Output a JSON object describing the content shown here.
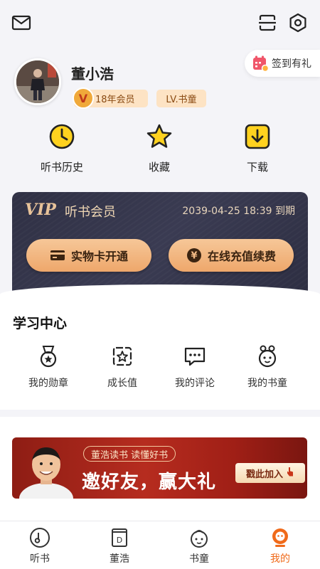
{
  "header": {
    "mail_icon": "mail-icon",
    "scan_icon": "scan-icon",
    "settings_icon": "settings-icon",
    "signin_label": "签到有礼"
  },
  "profile": {
    "name": "董小浩",
    "vip_badge": "18年会员",
    "vip_badge_mark": "V",
    "level_badge": "LV.书童"
  },
  "quick_actions": [
    {
      "label": "听书历史",
      "icon": "clock-icon"
    },
    {
      "label": "收藏",
      "icon": "star-icon"
    },
    {
      "label": "下载",
      "icon": "download-icon"
    }
  ],
  "vip_card": {
    "logo": "VIP",
    "title": "听书会员",
    "expire": "2039-04-25 18:39 到期",
    "buttons": [
      {
        "label": "实物卡开通",
        "icon": "card-icon"
      },
      {
        "label": "在线充值续费",
        "icon": "yen-icon"
      }
    ]
  },
  "study_center": {
    "title": "学习中心",
    "items": [
      {
        "label": "我的勋章",
        "icon": "medal-icon"
      },
      {
        "label": "成长值",
        "icon": "growth-icon"
      },
      {
        "label": "我的评论",
        "icon": "comment-icon"
      },
      {
        "label": "我的书童",
        "icon": "bookboy-icon"
      }
    ]
  },
  "banner": {
    "tag": "董浩读书 读懂好书",
    "headline": "邀好友，赢大礼",
    "button": "戳此加入"
  },
  "tabbar": {
    "active_color": "#f06a1a",
    "items": [
      {
        "label": "听书",
        "icon": "disc-icon"
      },
      {
        "label": "董浩",
        "icon": "book-d-icon"
      },
      {
        "label": "书童",
        "icon": "child-face-icon"
      },
      {
        "label": "我的",
        "icon": "profile-icon"
      }
    ]
  }
}
